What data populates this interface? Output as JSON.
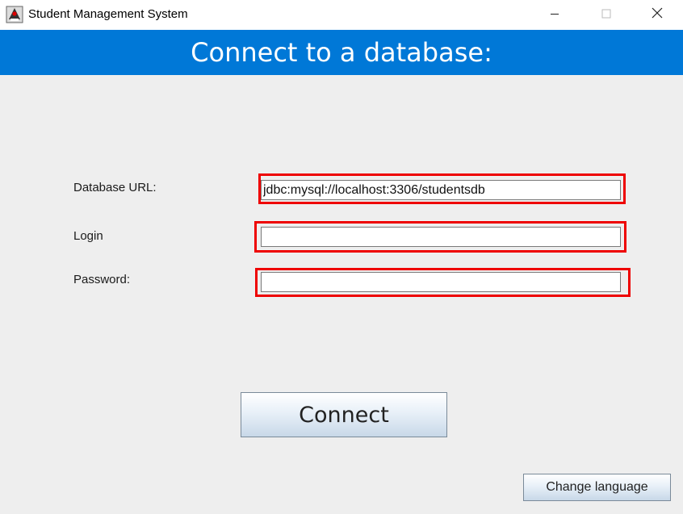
{
  "window": {
    "title": "Student Management System",
    "app_icon": "java-duke-icon",
    "controls": [
      "minimize-icon",
      "maximize-icon",
      "close-icon"
    ]
  },
  "header": {
    "title": "Connect to a database:",
    "background_color": "#0078d7"
  },
  "form": {
    "db_url": {
      "label": "Database URL:",
      "value": "jdbc:mysql://localhost:3306/studentsdb"
    },
    "login": {
      "label": "Login",
      "value": ""
    },
    "password": {
      "label": "Password:",
      "value": ""
    },
    "highlight_color": "#ee0000"
  },
  "buttons": {
    "connect_label": "Connect",
    "change_language_label": "Change language"
  }
}
